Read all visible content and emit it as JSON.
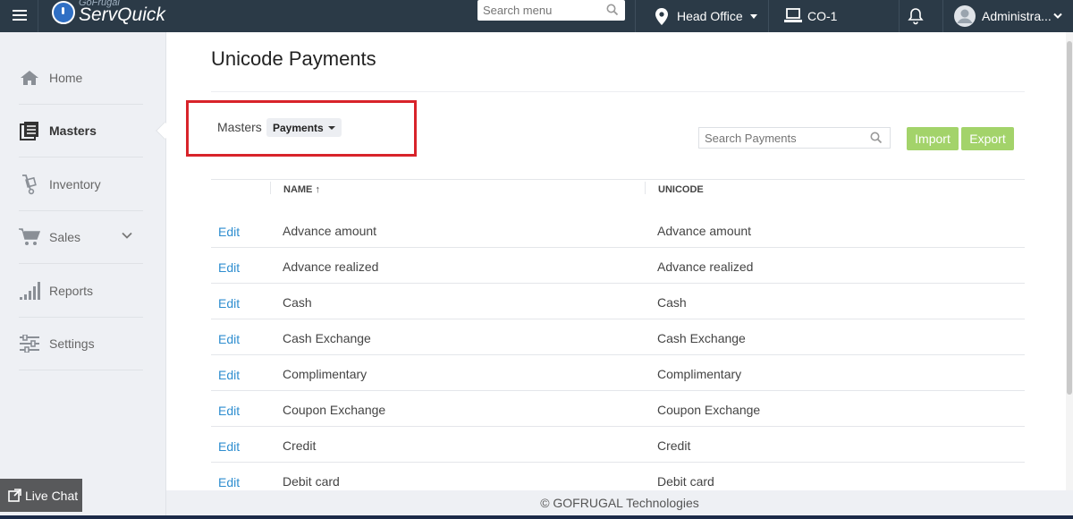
{
  "topbar": {
    "logo_small": "GoFrugal",
    "logo_big": "ServQuick",
    "search_placeholder": "Search menu",
    "location": "Head Office",
    "counter": "CO-1",
    "user": "Administra..."
  },
  "sidebar": {
    "items": [
      {
        "label": "Home",
        "icon": "home-icon"
      },
      {
        "label": "Masters",
        "icon": "masters-icon",
        "active": true
      },
      {
        "label": "Inventory",
        "icon": "inventory-icon"
      },
      {
        "label": "Sales",
        "icon": "cart-icon"
      },
      {
        "label": "Reports",
        "icon": "reports-icon"
      },
      {
        "label": "Settings",
        "icon": "settings-icon"
      }
    ]
  },
  "main": {
    "title": "Unicode Payments",
    "breadcrumb": "Masters",
    "dropdown": "Payments",
    "search_placeholder": "Search Payments",
    "import_label": "Import",
    "export_label": "Export",
    "columns": {
      "name": "NAME",
      "sort_indicator": "↑",
      "unicode": "UNICODE"
    },
    "rows": [
      {
        "edit": "Edit",
        "name": "Advance amount",
        "unicode": "Advance amount"
      },
      {
        "edit": "Edit",
        "name": "Advance realized",
        "unicode": "Advance realized"
      },
      {
        "edit": "Edit",
        "name": "Cash",
        "unicode": "Cash"
      },
      {
        "edit": "Edit",
        "name": "Cash Exchange",
        "unicode": "Cash Exchange"
      },
      {
        "edit": "Edit",
        "name": "Complimentary",
        "unicode": "Complimentary"
      },
      {
        "edit": "Edit",
        "name": "Coupon Exchange",
        "unicode": "Coupon Exchange"
      },
      {
        "edit": "Edit",
        "name": "Credit",
        "unicode": "Credit"
      },
      {
        "edit": "Edit",
        "name": "Debit card",
        "unicode": "Debit card"
      }
    ]
  },
  "footer": {
    "text": "© GOFRUGAL Technologies"
  },
  "livechat": {
    "label": "Live Chat"
  },
  "colors": {
    "topbar": "#2b3a47",
    "accent_button": "#a3d36a",
    "link": "#2f8ed0",
    "highlight": "#d8232a"
  }
}
